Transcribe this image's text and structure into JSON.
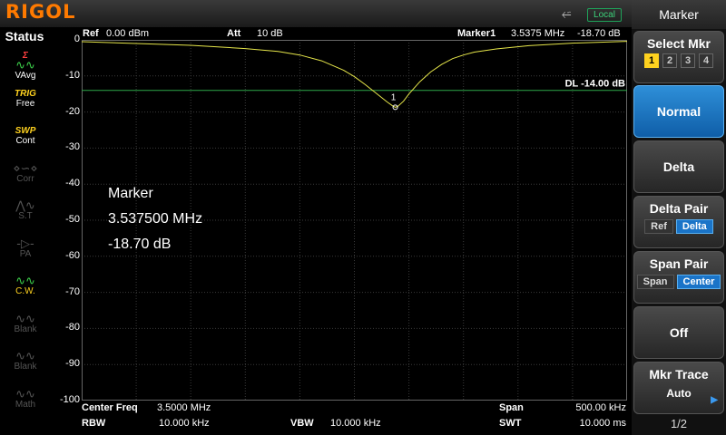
{
  "brand": "RIGOL",
  "topbar": {
    "usb_icon": "usb-icon",
    "remote_status": "Local"
  },
  "status_panel": {
    "title": "Status",
    "items": [
      {
        "top": "Σ",
        "glyph": "∿∿",
        "label": "VAvg",
        "icon": "average-icon",
        "state": "active"
      },
      {
        "top": "TRIG",
        "glyph": "",
        "label": "Free",
        "icon": "trigger-icon",
        "state": "active"
      },
      {
        "top": "SWP",
        "glyph": "",
        "label": "Cont",
        "icon": "sweep-icon",
        "state": "active"
      },
      {
        "top": "",
        "glyph": "⋄∽⋄",
        "label": "Corr",
        "icon": "correction-icon",
        "state": "dim"
      },
      {
        "top": "",
        "glyph": "⋀∿",
        "label": "S.T",
        "icon": "source-tracking-icon",
        "state": "dim"
      },
      {
        "top": "",
        "glyph": "-▷-",
        "label": "PA",
        "icon": "preamp-icon",
        "state": "dim"
      },
      {
        "top": "",
        "glyph": "∿∿",
        "label": "C.W.",
        "icon": "cw-icon",
        "state": "active"
      },
      {
        "top": "",
        "glyph": "∿∿",
        "label": "Blank",
        "icon": "trace-blank-icon",
        "state": "dim"
      },
      {
        "top": "",
        "glyph": "∿∿",
        "label": "Blank",
        "icon": "trace-blank-icon",
        "state": "dim"
      },
      {
        "top": "",
        "glyph": "∿∿",
        "label": "Math",
        "icon": "trace-math-icon",
        "state": "dim"
      }
    ]
  },
  "header": {
    "ref_label": "Ref",
    "ref_value": "0.00 dBm",
    "att_label": "Att",
    "att_value": "10 dB",
    "marker_label": "Marker1",
    "marker_freq": "3.5375 MHz",
    "marker_level": "-18.70 dB"
  },
  "display_line": {
    "label": "DL",
    "value": "-14.00 dB",
    "level": -14
  },
  "marker_readout": {
    "title": "Marker",
    "freq": "3.537500 MHz",
    "level": "-18.70 dB",
    "marker_number": "1"
  },
  "footer": {
    "center_freq_label": "Center Freq",
    "center_freq_value": "3.5000 MHz",
    "span_label": "Span",
    "span_value": "500.00 kHz",
    "rbw_label": "RBW",
    "rbw_value": "10.000 kHz",
    "vbw_label": "VBW",
    "vbw_value": "10.000 kHz",
    "swt_label": "SWT",
    "swt_value": "10.000 ms"
  },
  "menu": {
    "title": "Marker",
    "select_mkr": {
      "label": "Select Mkr",
      "options": [
        "1",
        "2",
        "3",
        "4"
      ],
      "selected": "1"
    },
    "normal": "Normal",
    "delta": "Delta",
    "delta_pair": {
      "label": "Delta Pair",
      "options": [
        "Ref",
        "Delta"
      ],
      "selected": "Delta"
    },
    "span_pair": {
      "label": "Span Pair",
      "options": [
        "Span",
        "Center"
      ],
      "selected": "Center"
    },
    "off": "Off",
    "mkr_trace": {
      "label": "Mkr Trace",
      "value": "Auto"
    },
    "page": "1/2"
  },
  "chart_data": {
    "type": "line",
    "xlabel": "",
    "ylabel": "",
    "xlim": [
      3.25,
      3.75
    ],
    "ylim": [
      -100,
      0
    ],
    "y_ticks": [
      0,
      -10,
      -20,
      -30,
      -40,
      -50,
      -60,
      -70,
      -80,
      -90,
      -100
    ],
    "grid": true,
    "trace_color": "#e6e64a",
    "dl_color": "#2ea84a",
    "series": [
      {
        "x": [
          3.25,
          3.3,
          3.35,
          3.4,
          3.43,
          3.45,
          3.47,
          3.49,
          3.5,
          3.51,
          3.52,
          3.53,
          3.535,
          3.5375,
          3.54,
          3.545,
          3.55,
          3.56,
          3.57,
          3.58,
          3.59,
          3.6,
          3.61,
          3.63,
          3.66,
          3.7,
          3.75
        ],
        "y": [
          -0.5,
          -1.0,
          -1.5,
          -2.4,
          -3.2,
          -4.2,
          -5.8,
          -8.4,
          -10.2,
          -12.4,
          -14.8,
          -17.2,
          -18.3,
          -18.7,
          -18.4,
          -17.0,
          -15.0,
          -11.6,
          -8.9,
          -6.8,
          -5.2,
          -4.2,
          -3.4,
          -2.5,
          -1.6,
          -0.9,
          -0.4
        ]
      }
    ]
  }
}
